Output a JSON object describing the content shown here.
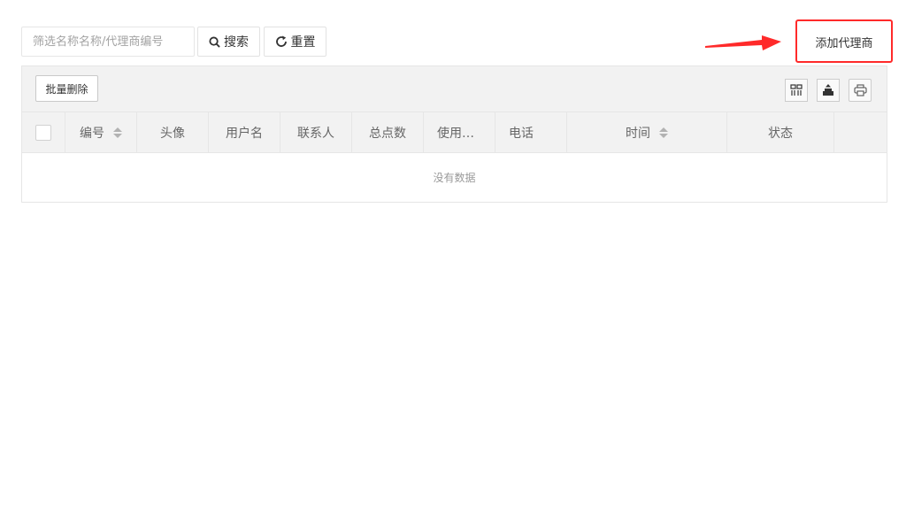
{
  "search": {
    "placeholder": "筛选名称名称/代理商编号",
    "value": ""
  },
  "buttons": {
    "search_label": "搜索",
    "reset_label": "重置",
    "add_label": "添加代理商"
  },
  "toolbar": {
    "batch_delete_label": "批量删除"
  },
  "table": {
    "columns": [
      "编号",
      "头像",
      "用户名",
      "联系人",
      "总点数",
      "使用…",
      "电话",
      "时间",
      "状态"
    ],
    "empty_text": "没有数据"
  },
  "colors": {
    "highlight": "#ff2a2a",
    "arrow": "#ff2a2a"
  },
  "icons": [
    "search-icon",
    "refresh-icon",
    "columns-icon",
    "export-icon",
    "print-icon"
  ]
}
